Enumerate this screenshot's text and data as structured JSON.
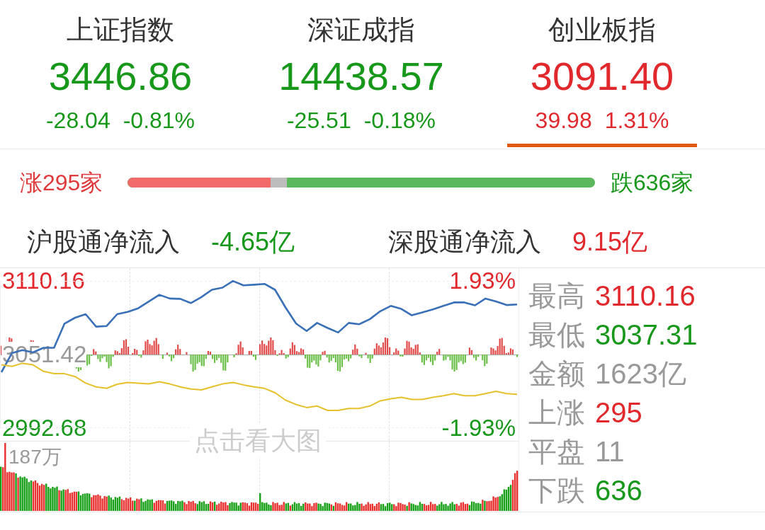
{
  "index_tabs": [
    {
      "name": "上证指数",
      "value": "3446.86",
      "change": "-28.04",
      "change_pct": "-0.81%",
      "color": "#17981b",
      "selected": false
    },
    {
      "name": "深证成指",
      "value": "14438.57",
      "change": "-25.51",
      "change_pct": "-0.18%",
      "color": "#17981b",
      "selected": false
    },
    {
      "name": "创业板指",
      "value": "3091.40",
      "change": "39.98",
      "change_pct": "1.31%",
      "color": "#e0282d",
      "selected": true
    }
  ],
  "breadth": {
    "up_label": "涨295家",
    "down_label": "跌636家",
    "level": 0.306
  },
  "northbound_flows": [
    {
      "label": "沪股通净流入",
      "value": "-4.65亿",
      "color": "#17981b"
    },
    {
      "label": "深股通净流入",
      "value": "9.15亿",
      "color": "#e0282d"
    }
  ],
  "chart": {
    "chart_data": {
      "type": "line",
      "series": [
        {
          "color": "#3a70b8",
          "values": [
            3037.3,
            3052.6,
            3054.9,
            3053.1,
            3056.8,
            3056.8,
            3076.1,
            3080.8,
            3083.6,
            3073.7,
            3074.2,
            3083.6,
            3085.5,
            3088.3,
            3093.7,
            3099.1,
            3096.1,
            3095.8,
            3092.5,
            3097.2,
            3103.1,
            3104.8,
            3110.1,
            3106.6,
            3107.1,
            3107.8,
            3103.1,
            3089.0,
            3076.1,
            3070.2,
            3076.6,
            3072.6,
            3069.0,
            3076.6,
            3075.6,
            3079.6,
            3086.0,
            3090.2,
            3087.8,
            3082.7,
            3085.0,
            3087.4,
            3090.2,
            3093.0,
            3093.0,
            3090.7,
            3096.1,
            3093.7,
            3090.9,
            3091.4
          ]
        },
        {
          "color": "#e6c12c",
          "values": [
            3043.2,
            3042.0,
            3044.4,
            3043.2,
            3038.0,
            3036.1,
            3036.1,
            3033.8,
            3028.6,
            3025.6,
            3024.4,
            3027.7,
            3029.1,
            3028.6,
            3027.9,
            3029.6,
            3027.9,
            3025.6,
            3023.9,
            3023.2,
            3025.6,
            3027.9,
            3029.1,
            3027.2,
            3025.6,
            3024.4,
            3020.9,
            3015.0,
            3011.5,
            3009.1,
            3010.3,
            3006.8,
            3006.8,
            3008.4,
            3008.4,
            3010.3,
            3014.5,
            3016.2,
            3017.3,
            3015.5,
            3015.5,
            3017.3,
            3018.5,
            3020.2,
            3018.5,
            3018.5,
            3020.2,
            3022.0,
            3020.2,
            3019.7
          ]
        }
      ],
      "ylim": [
        2992.68,
        3110.16
      ],
      "yticks": [
        {
          "value": 3110.16,
          "label": "3110.16"
        },
        {
          "value": 3051.42,
          "label": "3051.42"
        },
        {
          "value": 2992.68,
          "label": "2992.68"
        }
      ]
    },
    "percent_labels": [
      {
        "label": "1.93%",
        "color": "#e0282d"
      },
      {
        "label": "-1.93%",
        "color": "#17981b"
      }
    ],
    "enlarge_hint": "点击看大图",
    "volume_label": "187万"
  },
  "stats": [
    {
      "label": "最高",
      "value": "3110.16",
      "color": "#e0282d"
    },
    {
      "label": "最低",
      "value": "3037.31",
      "color": "#17981b"
    },
    {
      "label": "金额",
      "value": "1623亿",
      "color": "#999999"
    },
    {
      "label": "上涨",
      "value": "295",
      "color": "#e0282d"
    },
    {
      "label": "平盘",
      "value": "11",
      "color": "#999999"
    },
    {
      "label": "下跌",
      "value": "636",
      "color": "#17981b"
    }
  ]
}
